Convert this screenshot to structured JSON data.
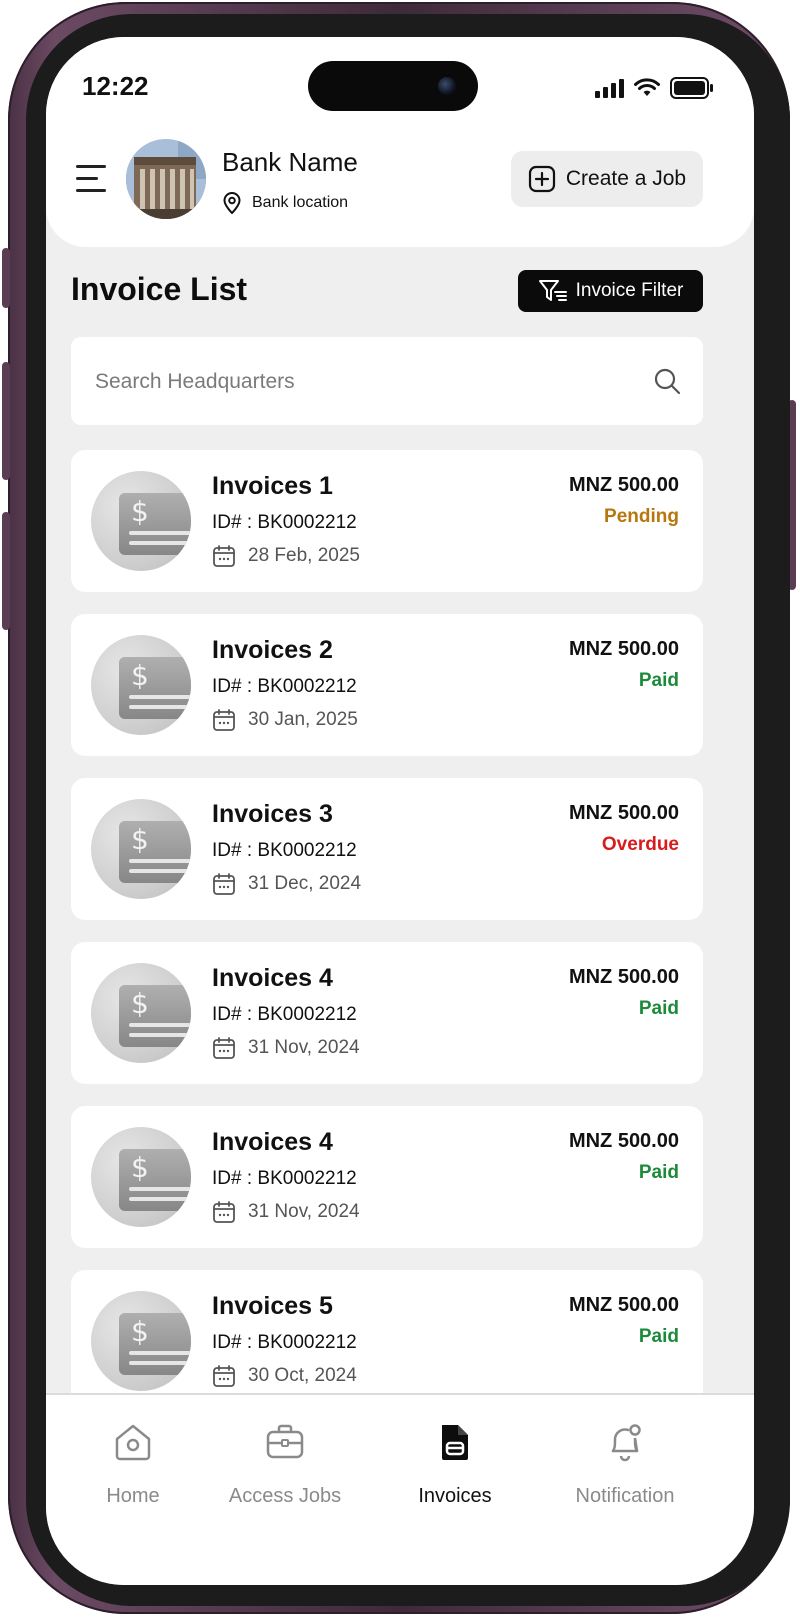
{
  "status_bar": {
    "time": "12:22"
  },
  "header": {
    "bank_name": "Bank Name",
    "bank_location": "Bank location",
    "create_button": "Create a Job"
  },
  "page": {
    "title": "Invoice List",
    "filter_button": "Invoice Filter"
  },
  "search": {
    "placeholder": "Search Headquarters",
    "value": ""
  },
  "invoices": [
    {
      "title": "Invoices 1",
      "id": "ID# : BK0002212",
      "date": "28 Feb, 2025",
      "amount": "MNZ 500.00",
      "status": "Pending"
    },
    {
      "title": "Invoices 2",
      "id": "ID# : BK0002212",
      "date": "30 Jan, 2025",
      "amount": "MNZ 500.00",
      "status": "Paid"
    },
    {
      "title": "Invoices 3",
      "id": "ID# : BK0002212",
      "date": "31 Dec, 2024",
      "amount": "MNZ 500.00",
      "status": "Overdue"
    },
    {
      "title": "Invoices 4",
      "id": "ID# : BK0002212",
      "date": "31 Nov, 2024",
      "amount": "MNZ 500.00",
      "status": "Paid"
    },
    {
      "title": "Invoices 4",
      "id": "ID# : BK0002212",
      "date": "31 Nov, 2024",
      "amount": "MNZ 500.00",
      "status": "Paid"
    },
    {
      "title": "Invoices 5",
      "id": "ID# : BK0002212",
      "date": "30 Oct, 2024",
      "amount": "MNZ 500.00",
      "status": "Paid"
    }
  ],
  "status_colors": {
    "Pending": "#b8760e",
    "Paid": "#1d8a3a",
    "Overdue": "#d81b1b"
  },
  "tabs": [
    {
      "label": "Home",
      "icon": "home-icon",
      "active": false
    },
    {
      "label": "Access Jobs",
      "icon": "briefcase-icon",
      "active": false
    },
    {
      "label": "Invoices",
      "icon": "invoice-icon",
      "active": true
    },
    {
      "label": "Notification",
      "icon": "bell-icon",
      "active": false
    }
  ]
}
